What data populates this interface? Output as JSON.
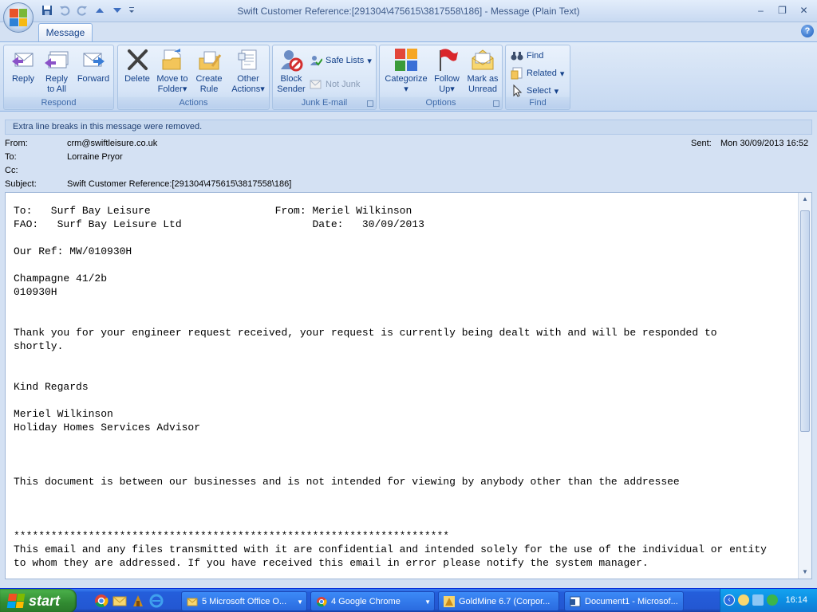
{
  "window": {
    "title": "Swift Customer Reference:[291304\\475615\\3817558\\186] - Message (Plain Text)",
    "minimize": "–",
    "restore": "❐",
    "close": "✕"
  },
  "qat": [
    "save-icon",
    "undo-icon",
    "redo-icon",
    "prev-item-icon",
    "next-item-icon"
  ],
  "ribbon": {
    "tab": "Message",
    "help": "?",
    "groups": {
      "respond": {
        "label": "Respond",
        "reply": "Reply",
        "reply_all_1": "Reply",
        "reply_all_2": "to All",
        "forward": "Forward"
      },
      "actions": {
        "label": "Actions",
        "delete": "Delete",
        "move_1": "Move to",
        "move_2": "Folder",
        "rule_1": "Create",
        "rule_2": "Rule",
        "other_1": "Other",
        "other_2": "Actions"
      },
      "junk": {
        "label": "Junk E-mail",
        "block_1": "Block",
        "block_2": "Sender",
        "safe_lists": "Safe Lists",
        "not_junk": "Not Junk"
      },
      "options": {
        "label": "Options",
        "categorize": "Categorize",
        "follow_1": "Follow",
        "follow_2": "Up",
        "mark_1": "Mark as",
        "mark_2": "Unread"
      },
      "find": {
        "label": "Find",
        "find": "Find",
        "related": "Related",
        "select": "Select"
      }
    },
    "colors": {
      "accent": "#15428b",
      "ribbon_bg": "#d4e1f3"
    }
  },
  "infobar": "Extra line breaks in this message were removed.",
  "headers": {
    "from_label": "From:",
    "from_value": "crm@swiftleisure.co.uk",
    "to_label": "To:",
    "to_value": "Lorraine Pryor",
    "cc_label": "Cc:",
    "cc_value": "",
    "subject_label": "Subject:",
    "subject_value": "Swift Customer Reference:[291304\\475615\\3817558\\186]",
    "sent_label": "Sent:",
    "sent_value": "Mon 30/09/2013 16:52"
  },
  "body": "To:   Surf Bay Leisure                    From: Meriel Wilkinson\nFAO:   Surf Bay Leisure Ltd                     Date:   30/09/2013\n\nOur Ref: MW/010930H\n\nChampagne 41/2b\n010930H\n\n\nThank you for your engineer request received, your request is currently being dealt with and will be responded to\nshortly.\n\n\nKind Regards\n\nMeriel Wilkinson\nHoliday Homes Services Advisor\n\n\n\nThis document is between our businesses and is not intended for viewing by anybody other than the addressee\n\n\n\n**********************************************************************\nThis email and any files transmitted with it are confidential and intended solely for the use of the individual or entity\nto whom they are addressed. If you have received this email in error please notify the system manager.",
  "taskbar": {
    "start": "start",
    "tasks": [
      {
        "label": "5 Microsoft Office O...",
        "icon": "outlook-icon"
      },
      {
        "label": "4 Google Chrome",
        "icon": "chrome-icon"
      },
      {
        "label": "GoldMine 6.7 (Corpor...",
        "icon": "goldmine-icon"
      },
      {
        "label": "Document1 - Microsof...",
        "icon": "word-icon"
      }
    ],
    "clock": "16:14"
  }
}
